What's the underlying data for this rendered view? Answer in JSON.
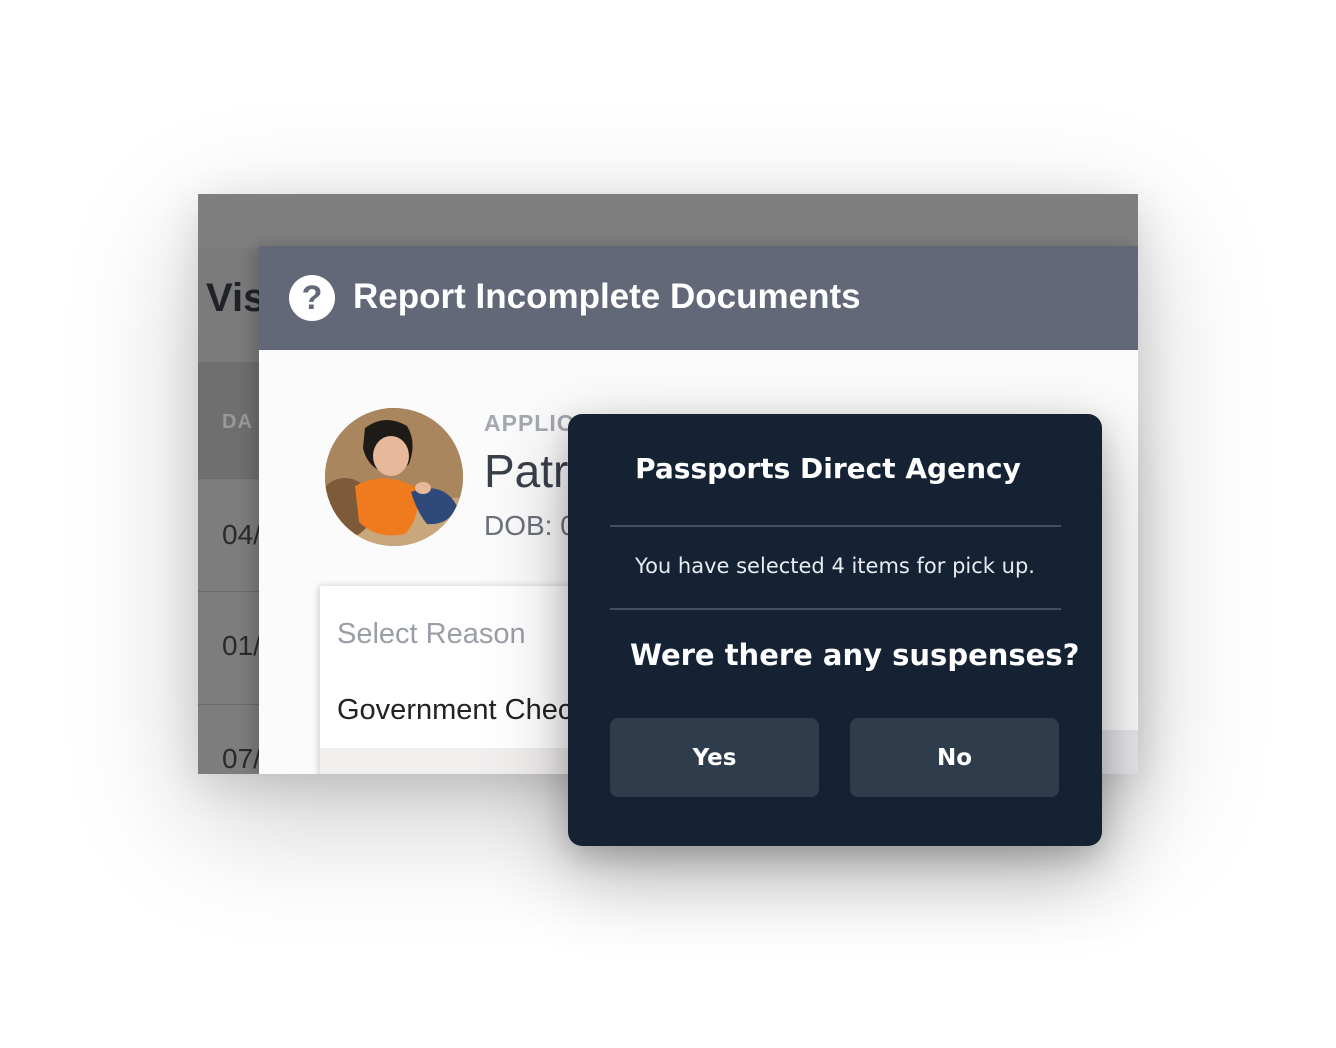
{
  "background_page": {
    "title_partial": "Vis",
    "table_header_partial": "DA",
    "rows": [
      "04/",
      "01/",
      "07/"
    ]
  },
  "report_modal": {
    "icon": "question-circle-icon",
    "title": "Report Incomplete Documents",
    "applicant": {
      "label_partial": "APPLIC",
      "name_partial": "Patr",
      "dob_partial": "DOB: 0"
    },
    "reason_select": {
      "placeholder": "Select Reason",
      "option_partial": "Government Chec"
    }
  },
  "dialog": {
    "title": "Passports Direct Agency",
    "message": "You have selected 4 items for pick up.",
    "question": "Were there any suspenses?",
    "yes_label": "Yes",
    "no_label": "No"
  },
  "colors": {
    "report_header": "#626877",
    "dialog_background": "#142233",
    "dialog_button": "#2f3c4b",
    "overlay_gray": "#7d7d7d"
  }
}
